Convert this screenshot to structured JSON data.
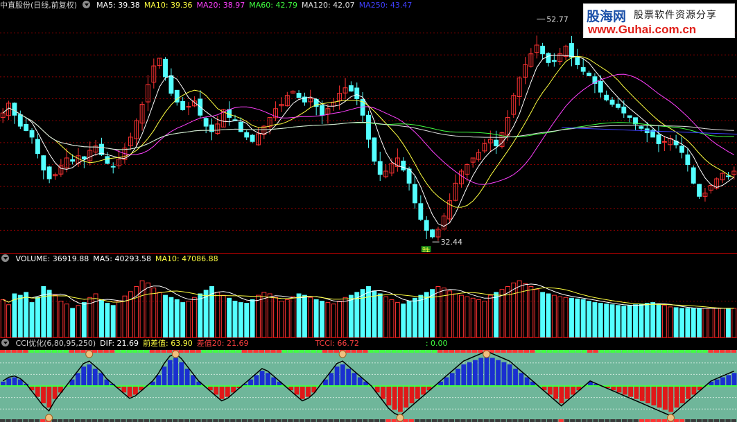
{
  "colors": {
    "up": "#ff3232",
    "down": "#54ffff",
    "ma5": "#ffffff",
    "ma10": "#ffff40",
    "ma20": "#ff40ff",
    "ma60": "#40ff40",
    "ma120": "#e0e0e0",
    "ma250": "#4040ff",
    "grid": "#8b0000",
    "cci_bg": "#6fb69a"
  },
  "price_panel": {
    "title": "中直股份(日线,前复权)",
    "indicators": [
      {
        "label": "MA5: 39.38",
        "color": "#ffffff"
      },
      {
        "label": "MA10: 39.36",
        "color": "#ffff40"
      },
      {
        "label": "MA20: 38.97",
        "color": "#ff40ff"
      },
      {
        "label": "MA60: 42.79",
        "color": "#40ff40"
      },
      {
        "label": "MA120: 42.07",
        "color": "#e0e0e0"
      },
      {
        "label": "MA250: 43.47",
        "color": "#4040ff"
      }
    ],
    "high_label": "52.77",
    "low_label": "32.44",
    "signal_label": "跌"
  },
  "volume_panel": {
    "indicators": [
      {
        "label": "VOLUME: 36919.88",
        "color": "#ffffff"
      },
      {
        "label": "MA5: 40293.58",
        "color": "#ffffff"
      },
      {
        "label": "MA10: 47086.88",
        "color": "#ffff40"
      }
    ]
  },
  "cci_panel": {
    "indicators": [
      {
        "label": "CCI优化(6,80,95,250)",
        "color": "#cfcfcf"
      },
      {
        "label": "DIF: 21.69",
        "color": "#ffffff"
      },
      {
        "label": "前差值: 63.90",
        "color": "#ffff40"
      },
      {
        "label": "差值20: 21.69",
        "color": "#ff4040"
      },
      {
        "label": "TCCI: 66.72",
        "color": "#ff4040",
        "gap": true
      },
      {
        "label": ": 0.00",
        "color": "#40ff40",
        "gap": true
      }
    ]
  },
  "watermark": {
    "brand": "股海网",
    "slogan": "股票软件资源分享",
    "url": "www.Guhai.com.cn"
  },
  "chart_data": [
    {
      "type": "candlestick",
      "title": "中直股份(日线,前复权)",
      "annotations": [
        {
          "text": "52.77",
          "kind": "high"
        },
        {
          "text": "32.44",
          "kind": "low"
        },
        {
          "text": "跌",
          "kind": "signal"
        }
      ],
      "close_series": [
        44.2,
        45.1,
        44.0,
        43.0,
        42.6,
        42.0,
        40.5,
        39.0,
        38.2,
        38.6,
        39.4,
        40.1,
        39.8,
        40.3,
        40.0,
        40.8,
        41.2,
        40.4,
        39.6,
        39.3,
        40.0,
        41.0,
        42.0,
        43.5,
        45.0,
        46.8,
        48.5,
        49.2,
        47.5,
        46.0,
        45.2,
        44.5,
        44.8,
        45.3,
        44.0,
        43.0,
        42.5,
        43.2,
        44.5,
        43.8,
        43.5,
        42.5,
        42.0,
        41.6,
        42.3,
        43.0,
        43.8,
        44.6,
        45.0,
        45.8,
        46.2,
        45.6,
        45.2,
        45.5,
        44.8,
        44.0,
        44.6,
        45.2,
        46.0,
        46.5,
        46.2,
        45.5,
        44.0,
        41.8,
        39.8,
        38.6,
        38.9,
        39.6,
        40.1,
        39.0,
        37.8,
        36.0,
        34.5,
        33.5,
        32.9,
        33.6,
        34.8,
        36.2,
        37.8,
        38.9,
        39.5,
        40.1,
        40.6,
        41.4,
        41.8,
        41.2,
        42.4,
        43.8,
        45.8,
        47.4,
        48.6,
        49.6,
        50.4,
        49.6,
        48.8,
        48.9,
        49.6,
        50.3,
        49.3,
        48.6,
        48.0,
        47.6,
        46.9,
        46.1,
        45.4,
        45.0,
        44.7,
        44.2,
        43.8,
        43.2,
        42.8,
        42.4,
        42.0,
        41.4,
        41.6,
        41.9,
        41.3,
        40.6,
        39.5,
        37.8,
        36.6,
        36.9,
        37.6,
        38.2,
        38.7,
        38.4,
        38.9
      ],
      "ma_labels": {
        "MA5": 39.38,
        "MA10": 39.36,
        "MA20": 38.97,
        "MA60": 42.79,
        "MA120": 42.07,
        "MA250": 43.47
      },
      "ylim": [
        31.5,
        53.5
      ]
    },
    {
      "type": "bar",
      "title": "VOLUME",
      "values": [
        52,
        45,
        60,
        58,
        62,
        48,
        55,
        70,
        65,
        58,
        50,
        46,
        40,
        44,
        48,
        55,
        60,
        52,
        47,
        44,
        50,
        57,
        63,
        70,
        78,
        75,
        68,
        62,
        58,
        55,
        52,
        48,
        50,
        55,
        60,
        65,
        70,
        62,
        58,
        54,
        50,
        48,
        47,
        52,
        58,
        62,
        60,
        55,
        50,
        52,
        56,
        60,
        58,
        55,
        52,
        50,
        48,
        46,
        50,
        55,
        58,
        62,
        66,
        70,
        64,
        60,
        56,
        52,
        48,
        46,
        50,
        54,
        58,
        62,
        66,
        70,
        68,
        64,
        60,
        58,
        56,
        54,
        52,
        50,
        58,
        62,
        66,
        70,
        75,
        78,
        74,
        70,
        66,
        62,
        60,
        58,
        56,
        55,
        54,
        53,
        52,
        50,
        48,
        47,
        46,
        45,
        44,
        43,
        44,
        45,
        46,
        47,
        48,
        46,
        44,
        42,
        41,
        40,
        40,
        40,
        40,
        40,
        40,
        40,
        40,
        40,
        40
      ],
      "labels": {
        "VOLUME": 36919.88,
        "MA5": 40293.58,
        "MA10": 47086.88
      }
    },
    {
      "type": "bar",
      "title": "CCI优化(6,80,95,250)",
      "values": [
        20,
        35,
        40,
        30,
        10,
        -20,
        -50,
        -80,
        -100,
        -60,
        -30,
        0,
        30,
        60,
        90,
        100,
        80,
        60,
        30,
        10,
        -10,
        -30,
        -50,
        -40,
        -20,
        0,
        20,
        50,
        90,
        120,
        130,
        110,
        80,
        50,
        20,
        0,
        -20,
        -40,
        -60,
        -50,
        -30,
        -10,
        10,
        30,
        50,
        70,
        60,
        40,
        20,
        0,
        -20,
        -40,
        -60,
        -50,
        -30,
        0,
        30,
        60,
        90,
        100,
        80,
        60,
        40,
        20,
        0,
        -30,
        -60,
        -90,
        -110,
        -120,
        -100,
        -80,
        -60,
        -40,
        -20,
        0,
        20,
        40,
        60,
        80,
        100,
        110,
        120,
        130,
        140,
        130,
        120,
        110,
        100,
        80,
        60,
        40,
        20,
        0,
        -20,
        -40,
        -60,
        -80,
        -60,
        -40,
        -20,
        0,
        20,
        10,
        0,
        -10,
        -20,
        -30,
        -40,
        -50,
        -60,
        -70,
        -80,
        -90,
        -100,
        -110,
        -120,
        -100,
        -80,
        -60,
        -40,
        -20,
        0,
        20,
        30,
        40,
        50,
        60
      ],
      "labels": {
        "DIF": 21.69,
        "前差值": 63.9,
        "差值20": 21.69,
        "TCCI": 66.72,
        "": 0.0
      }
    }
  ]
}
